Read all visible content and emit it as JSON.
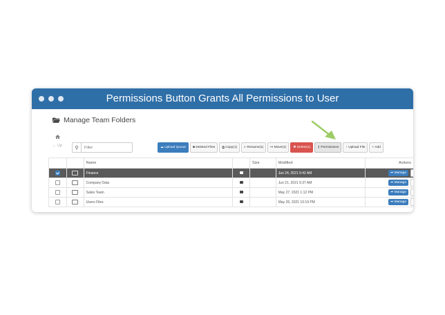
{
  "window": {
    "title": "Permissions Button Grants All Permissions to User"
  },
  "page": {
    "heading": "Manage Team Folders"
  },
  "nav": {
    "up_label": "← Up"
  },
  "filter": {
    "placeholder": "Filter"
  },
  "toolbar": {
    "upload_queue": "Upload Queue",
    "deleted_files": "Deleted Files",
    "copy": "Copy(1)",
    "rename": "Rename(1)",
    "move": "Move(1)",
    "delete": "Delete(1)",
    "permissions": "Permissions",
    "upload_file": "Upload File",
    "add": "+ Add"
  },
  "table": {
    "headers": {
      "name": "Name",
      "size": "Size",
      "modified": "Modified",
      "actions": "Actions"
    },
    "rows": [
      {
        "name": "Finance",
        "size": "",
        "modified": "Jun 24, 2021 9:42 AM",
        "action": "Manage",
        "selected": true
      },
      {
        "name": "Company Data",
        "size": "",
        "modified": "Jun 21, 2021 9:37 AM",
        "action": "Manage",
        "selected": false
      },
      {
        "name": "Sales Team",
        "size": "",
        "modified": "May 27, 2021 1:12 PM",
        "action": "Manage",
        "selected": false
      },
      {
        "name": "Users Files",
        "size": "",
        "modified": "May 26, 2021 10:19 PM",
        "action": "Manage",
        "selected": false
      }
    ]
  },
  "icons": [
    "folder-open-icon",
    "home-icon",
    "search-icon",
    "cloud-upload-icon",
    "trash-icon",
    "copy-icon",
    "rename-icon",
    "move-icon",
    "key-icon",
    "upload-icon",
    "folder-icon",
    "share-icon",
    "share-arrow-icon",
    "download-icon",
    "green-arrow-icon"
  ],
  "colors": {
    "titlebar": "#2f6fa8",
    "primary": "#3c7dbd",
    "danger": "#d9534f",
    "selected_row": "#5a5a5a",
    "arrow": "#9ccc65"
  }
}
